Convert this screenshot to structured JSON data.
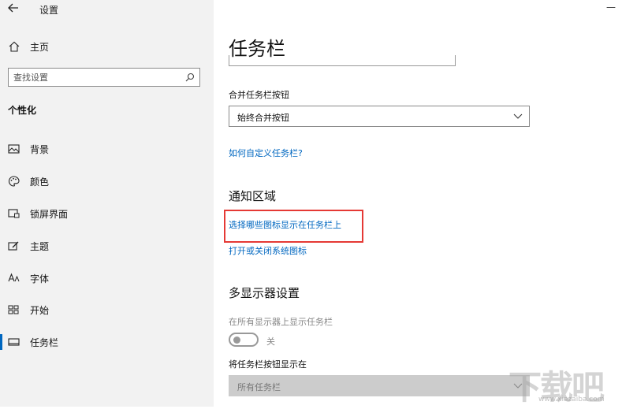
{
  "window": {
    "title": "设置"
  },
  "sidebar": {
    "home_label": "主页",
    "search_placeholder": "查找设置",
    "section_title": "个性化",
    "items": [
      {
        "label": "背景",
        "icon": "image-icon"
      },
      {
        "label": "颜色",
        "icon": "palette-icon"
      },
      {
        "label": "锁屏界面",
        "icon": "lock-screen-icon"
      },
      {
        "label": "主题",
        "icon": "theme-icon"
      },
      {
        "label": "字体",
        "icon": "font-icon"
      },
      {
        "label": "开始",
        "icon": "start-icon"
      },
      {
        "label": "任务栏",
        "icon": "taskbar-icon",
        "selected": true
      }
    ]
  },
  "main": {
    "page_title": "任务栏",
    "combine_label": "合并任务栏按钮",
    "combine_value": "始终合并按钮",
    "customize_link": "如何自定义任务栏?",
    "notification_heading": "通知区域",
    "notification_link_icons": "选择哪些图标显示在任务栏上",
    "notification_link_system": "打开或关闭系统图标",
    "multi_display_heading": "多显示器设置",
    "show_all_displays_label": "在所有显示器上显示任务栏",
    "show_all_displays_state": "关",
    "show_buttons_label": "将任务栏按钮显示在",
    "show_buttons_value": "所有任务栏"
  },
  "watermark": {
    "text": "下载吧",
    "url": "www.xiazaiba.com"
  },
  "colors": {
    "accent": "#0067c0",
    "highlight": "#e53935",
    "sidebar_bg": "#f2f2f2"
  }
}
